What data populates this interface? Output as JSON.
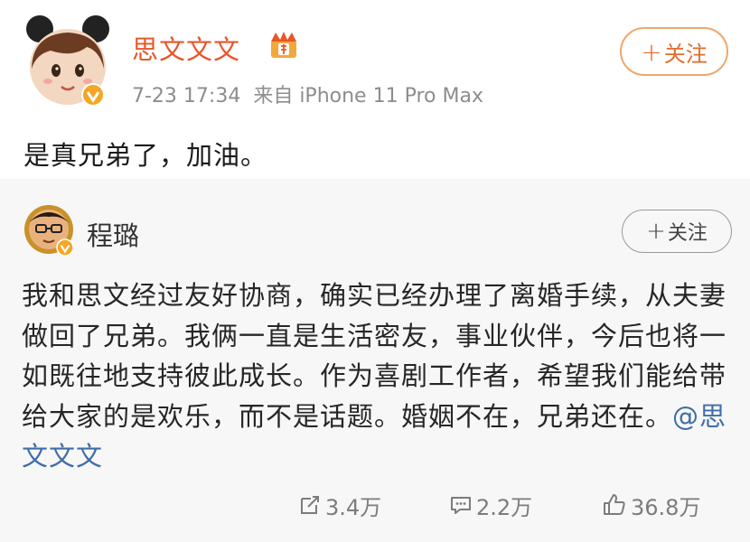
{
  "post": {
    "author": "思文文文",
    "timestamp": "7-23 17:34",
    "source": "来自 iPhone 11 Pro Max",
    "follow_label": "关注",
    "text": "是真兄弟了，加油。",
    "crown_icon": "vip-crown-icon",
    "verified_icon": "verified-badge-icon"
  },
  "repost": {
    "author": "程璐",
    "follow_label": "关注",
    "text": "我和思文经过友好协商，确实已经办理了离婚手续，从夫妻做回了兄弟。我俩一直是生活密友，事业伙伴，今后也将一如既往地支持彼此成长。作为喜剧工作者，希望我们能给带给大家的是欢乐，而不是话题。婚姻不在，兄弟还在。",
    "mention": "@思文文文",
    "stats": {
      "reposts": "3.4万",
      "comments": "2.2万",
      "likes": "36.8万"
    }
  },
  "colors": {
    "author": "#e8562a",
    "follow_border": "#f0a66a",
    "mention": "#3f6ea8",
    "panel_bg": "#f7f7f7"
  }
}
